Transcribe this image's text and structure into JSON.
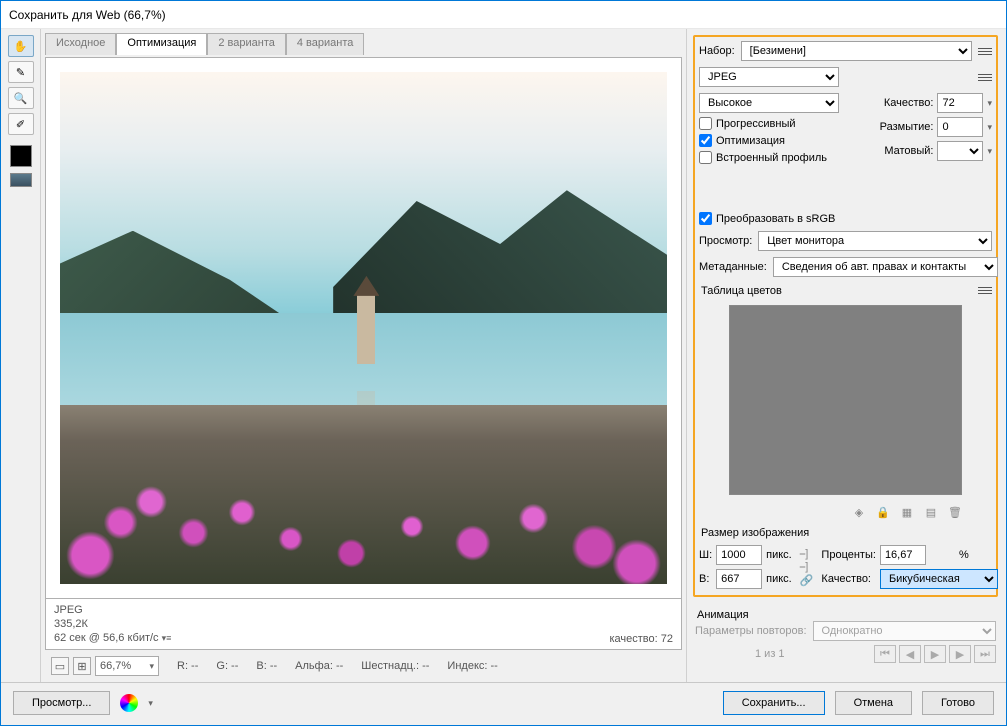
{
  "title": "Сохранить для Web (66,7%)",
  "tabs": {
    "t0": "Исходное",
    "t1": "Оптимизация",
    "t2": "2 варианта",
    "t3": "4 варианта"
  },
  "info": {
    "format": "JPEG",
    "size": "335,2К",
    "time": "62 сек @ 56,6 кбит/с",
    "qlabel": "качество: 72"
  },
  "status": {
    "zoom": "66,7%",
    "r": "R: --",
    "g": "G: --",
    "b": "B: --",
    "alpha": "Альфа: --",
    "hex": "Шестнадц.: --",
    "index": "Индекс: --"
  },
  "buttons": {
    "preview": "Просмотр...",
    "save": "Сохранить...",
    "cancel": "Отмена",
    "done": "Готово"
  },
  "preset": {
    "label": "Набор:",
    "value": "[Безимени]",
    "format": "JPEG",
    "quality_preset": "Высокое",
    "qlabel": "Качество:",
    "qval": "72",
    "blurlabel": "Размытие:",
    "blurval": "0",
    "mattelabel": "Матовый:",
    "chk_prog": "Прогрессивный",
    "chk_opt": "Оптимизация",
    "chk_icc": "Встроенный профиль"
  },
  "convert": {
    "chk": "Преобразовать в sRGB",
    "previewlabel": "Просмотр:",
    "previewval": "Цвет монитора",
    "metalabel": "Метаданные:",
    "metaval": "Сведения об авт. правах и контакты"
  },
  "colortable": {
    "title": "Таблица цветов"
  },
  "imgsize": {
    "title": "Размер изображения",
    "w": "Ш:",
    "wval": "1000",
    "h": "В:",
    "hval": "667",
    "px": "пикс.",
    "pct": "Проценты:",
    "pctval": "16,67",
    "pctunit": "%",
    "q": "Качество:",
    "qval": "Бикубическая"
  },
  "anim": {
    "title": "Анимация",
    "looplabel": "Параметры повторов:",
    "loopval": "Однократно",
    "frame": "1 из 1"
  }
}
